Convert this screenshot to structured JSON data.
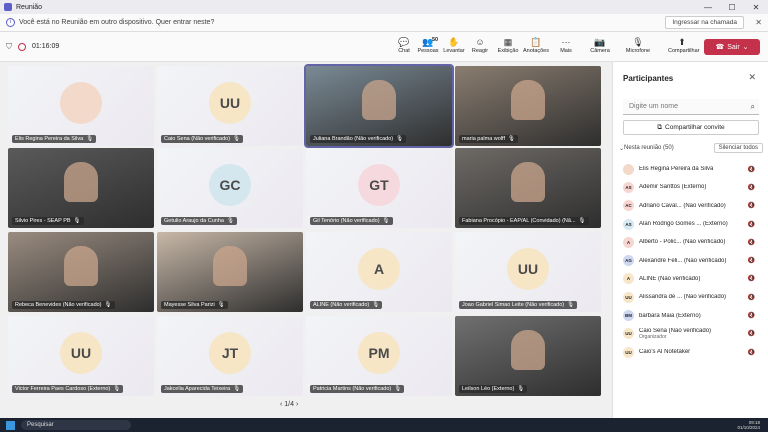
{
  "window": {
    "title": "Reunião"
  },
  "notice": {
    "text": "Você está no Reunião em outro dispositivo. Quer entrar neste?",
    "button": "Ingressar na chamada"
  },
  "toolbar": {
    "timer": "01:16:09",
    "buttons": [
      {
        "label": "Chat",
        "icon": "chat-icon",
        "glyph": "💬"
      },
      {
        "label": "Pessoas",
        "icon": "people-icon",
        "glyph": "👥",
        "badge": "50"
      },
      {
        "label": "Levantar",
        "icon": "raise-hand-icon",
        "glyph": "✋"
      },
      {
        "label": "Reagir",
        "icon": "react-icon",
        "glyph": "☺"
      },
      {
        "label": "Exibição",
        "icon": "view-icon",
        "glyph": "▦"
      },
      {
        "label": "Anotações",
        "icon": "notes-icon",
        "glyph": "📋"
      },
      {
        "label": "Mais",
        "icon": "more-icon",
        "glyph": "···"
      },
      {
        "label": "Câmera",
        "icon": "camera-off-icon",
        "glyph": "📷"
      },
      {
        "label": "Microfone",
        "icon": "mic-off-icon",
        "glyph": "🎙"
      },
      {
        "label": "Compartilhar",
        "icon": "share-icon",
        "glyph": "⬆"
      }
    ],
    "leave": "Sair"
  },
  "tiles": [
    {
      "name": "Elis Regina Pereira da Silva",
      "initials": "",
      "type": "photo"
    },
    {
      "name": "Caio Sena (Não verificado)",
      "initials": "UU",
      "type": "avatar"
    },
    {
      "name": "Juliana Brandão (Não verificado)",
      "initials": "",
      "type": "video",
      "active": true
    },
    {
      "name": "maria palma wolff",
      "initials": "",
      "type": "video"
    },
    {
      "name": "Silvio Pires - SEAP PB",
      "initials": "",
      "type": "video"
    },
    {
      "name": "Getulio Araujo da Cunha",
      "initials": "GC",
      "type": "avatar"
    },
    {
      "name": "Gil Tenório (Não verificado)",
      "initials": "GT",
      "type": "avatar"
    },
    {
      "name": "Fabiana Procópio - EAP/AL (Convidado) (Nã...",
      "initials": "",
      "type": "video"
    },
    {
      "name": "Rebeca Benevides (Não verificado)",
      "initials": "",
      "type": "video"
    },
    {
      "name": "Mayesse Silva Parizi",
      "initials": "",
      "type": "video"
    },
    {
      "name": "ALINE (Não verificado)",
      "initials": "A",
      "type": "avatar"
    },
    {
      "name": "Joao Gabriel Simao Leite (Não verificado)",
      "initials": "UU",
      "type": "avatar"
    },
    {
      "name": "Victor Ferreira Paes Cardoso (Externo)",
      "initials": "UU",
      "type": "avatar"
    },
    {
      "name": "Jakcelia Aparecida Teixeira",
      "initials": "JT",
      "type": "avatar"
    },
    {
      "name": "Patricia Martins (Não verificado)",
      "initials": "PM",
      "type": "avatar"
    },
    {
      "name": "Leilson Léo (Externo)",
      "initials": "",
      "type": "video"
    }
  ],
  "pager": "1/4",
  "panel": {
    "title": "Participantes",
    "search_placeholder": "Digite um nome",
    "share_invite": "Compartilhar convite",
    "section": "Nesta reunião (50)",
    "mute_all": "Silenciar todos",
    "participants": [
      {
        "initials": "",
        "name": "Elis Regina Pereira da Silva",
        "sub": "",
        "color": "#f3d9c9"
      },
      {
        "initials": "AS",
        "name": "Ademir Santtos (Externo)",
        "sub": "",
        "color": "#f7d5d0"
      },
      {
        "initials": "AC",
        "name": "Adriano Caval... (Não verificado)",
        "sub": "",
        "color": "#f7d5d0"
      },
      {
        "initials": "AS",
        "name": "Alan Rodrigo Gomes ... (Externo)",
        "sub": "",
        "color": "#d6e8f0"
      },
      {
        "initials": "A",
        "name": "Alberto - Polic... (Não verificado)",
        "sub": "",
        "color": "#f7d5d0"
      },
      {
        "initials": "AG",
        "name": "Alexandre Feli... (Não verificado)",
        "sub": "",
        "color": "#cdd7ef"
      },
      {
        "initials": "A",
        "name": "ALINE (Não verificado)",
        "sub": "",
        "color": "#f7e6c8"
      },
      {
        "initials": "UU",
        "name": "Alissandra de ... (Não verificado)",
        "sub": "",
        "color": "#f7e6c8"
      },
      {
        "initials": "BM",
        "name": "barbara Maia (Externo)",
        "sub": "",
        "color": "#cdd7ef"
      },
      {
        "initials": "UU",
        "name": "Caio Sena (Não verificado)",
        "sub": "Organizador",
        "color": "#f7e6c8"
      },
      {
        "initials": "UU",
        "name": "Caio's AI Notetaker",
        "sub": "",
        "color": "#f7e6c8"
      }
    ]
  },
  "taskbar": {
    "search": "Pesquisar",
    "time": "09:18",
    "date": "01/10/2024"
  }
}
